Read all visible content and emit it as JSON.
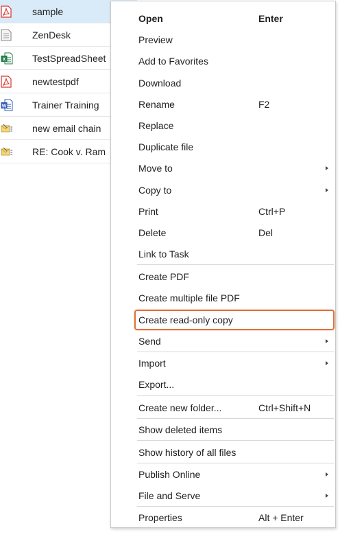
{
  "files": [
    {
      "name": "sample",
      "icon": "pdf-icon",
      "selected": true
    },
    {
      "name": "ZenDesk",
      "icon": "text-document-icon",
      "selected": false
    },
    {
      "name": "TestSpreadSheet",
      "icon": "excel-icon",
      "selected": false
    },
    {
      "name": "newtestpdf",
      "icon": "pdf-icon",
      "selected": false
    },
    {
      "name": "Trainer Training",
      "icon": "word-icon",
      "selected": false
    },
    {
      "name": "new email chain",
      "icon": "email-icon",
      "selected": false
    },
    {
      "name": "RE: Cook v. Ram",
      "icon": "email-icon",
      "selected": false
    }
  ],
  "context_menu": {
    "open": {
      "label": "Open",
      "shortcut": "Enter"
    },
    "preview": {
      "label": "Preview"
    },
    "add_favorites": {
      "label": "Add to Favorites"
    },
    "download": {
      "label": "Download"
    },
    "rename": {
      "label": "Rename",
      "shortcut": "F2"
    },
    "replace": {
      "label": "Replace"
    },
    "duplicate": {
      "label": "Duplicate file"
    },
    "move_to": {
      "label": "Move to"
    },
    "copy_to": {
      "label": "Copy to"
    },
    "print": {
      "label": "Print",
      "shortcut": "Ctrl+P"
    },
    "delete": {
      "label": "Delete",
      "shortcut": "Del"
    },
    "link_task": {
      "label": "Link to Task"
    },
    "create_pdf": {
      "label": "Create PDF"
    },
    "create_multi_pdf": {
      "label": "Create multiple file PDF"
    },
    "create_readonly": {
      "label": "Create read-only copy"
    },
    "send": {
      "label": "Send"
    },
    "import": {
      "label": "Import"
    },
    "export": {
      "label": "Export..."
    },
    "create_folder": {
      "label": "Create new folder...",
      "shortcut": "Ctrl+Shift+N"
    },
    "show_deleted": {
      "label": "Show deleted items"
    },
    "show_history": {
      "label": "Show history of all files"
    },
    "publish_online": {
      "label": "Publish Online"
    },
    "file_serve": {
      "label": "File and Serve"
    },
    "properties": {
      "label": "Properties",
      "shortcut": "Alt + Enter"
    }
  },
  "colors": {
    "selected_row": "#d9eaf8",
    "highlight_border": "#e0703a",
    "pdf_red": "#d9342b",
    "excel_green": "#1e7b45",
    "word_blue": "#2b5cb8",
    "email_yellow": "#e8c65a"
  }
}
